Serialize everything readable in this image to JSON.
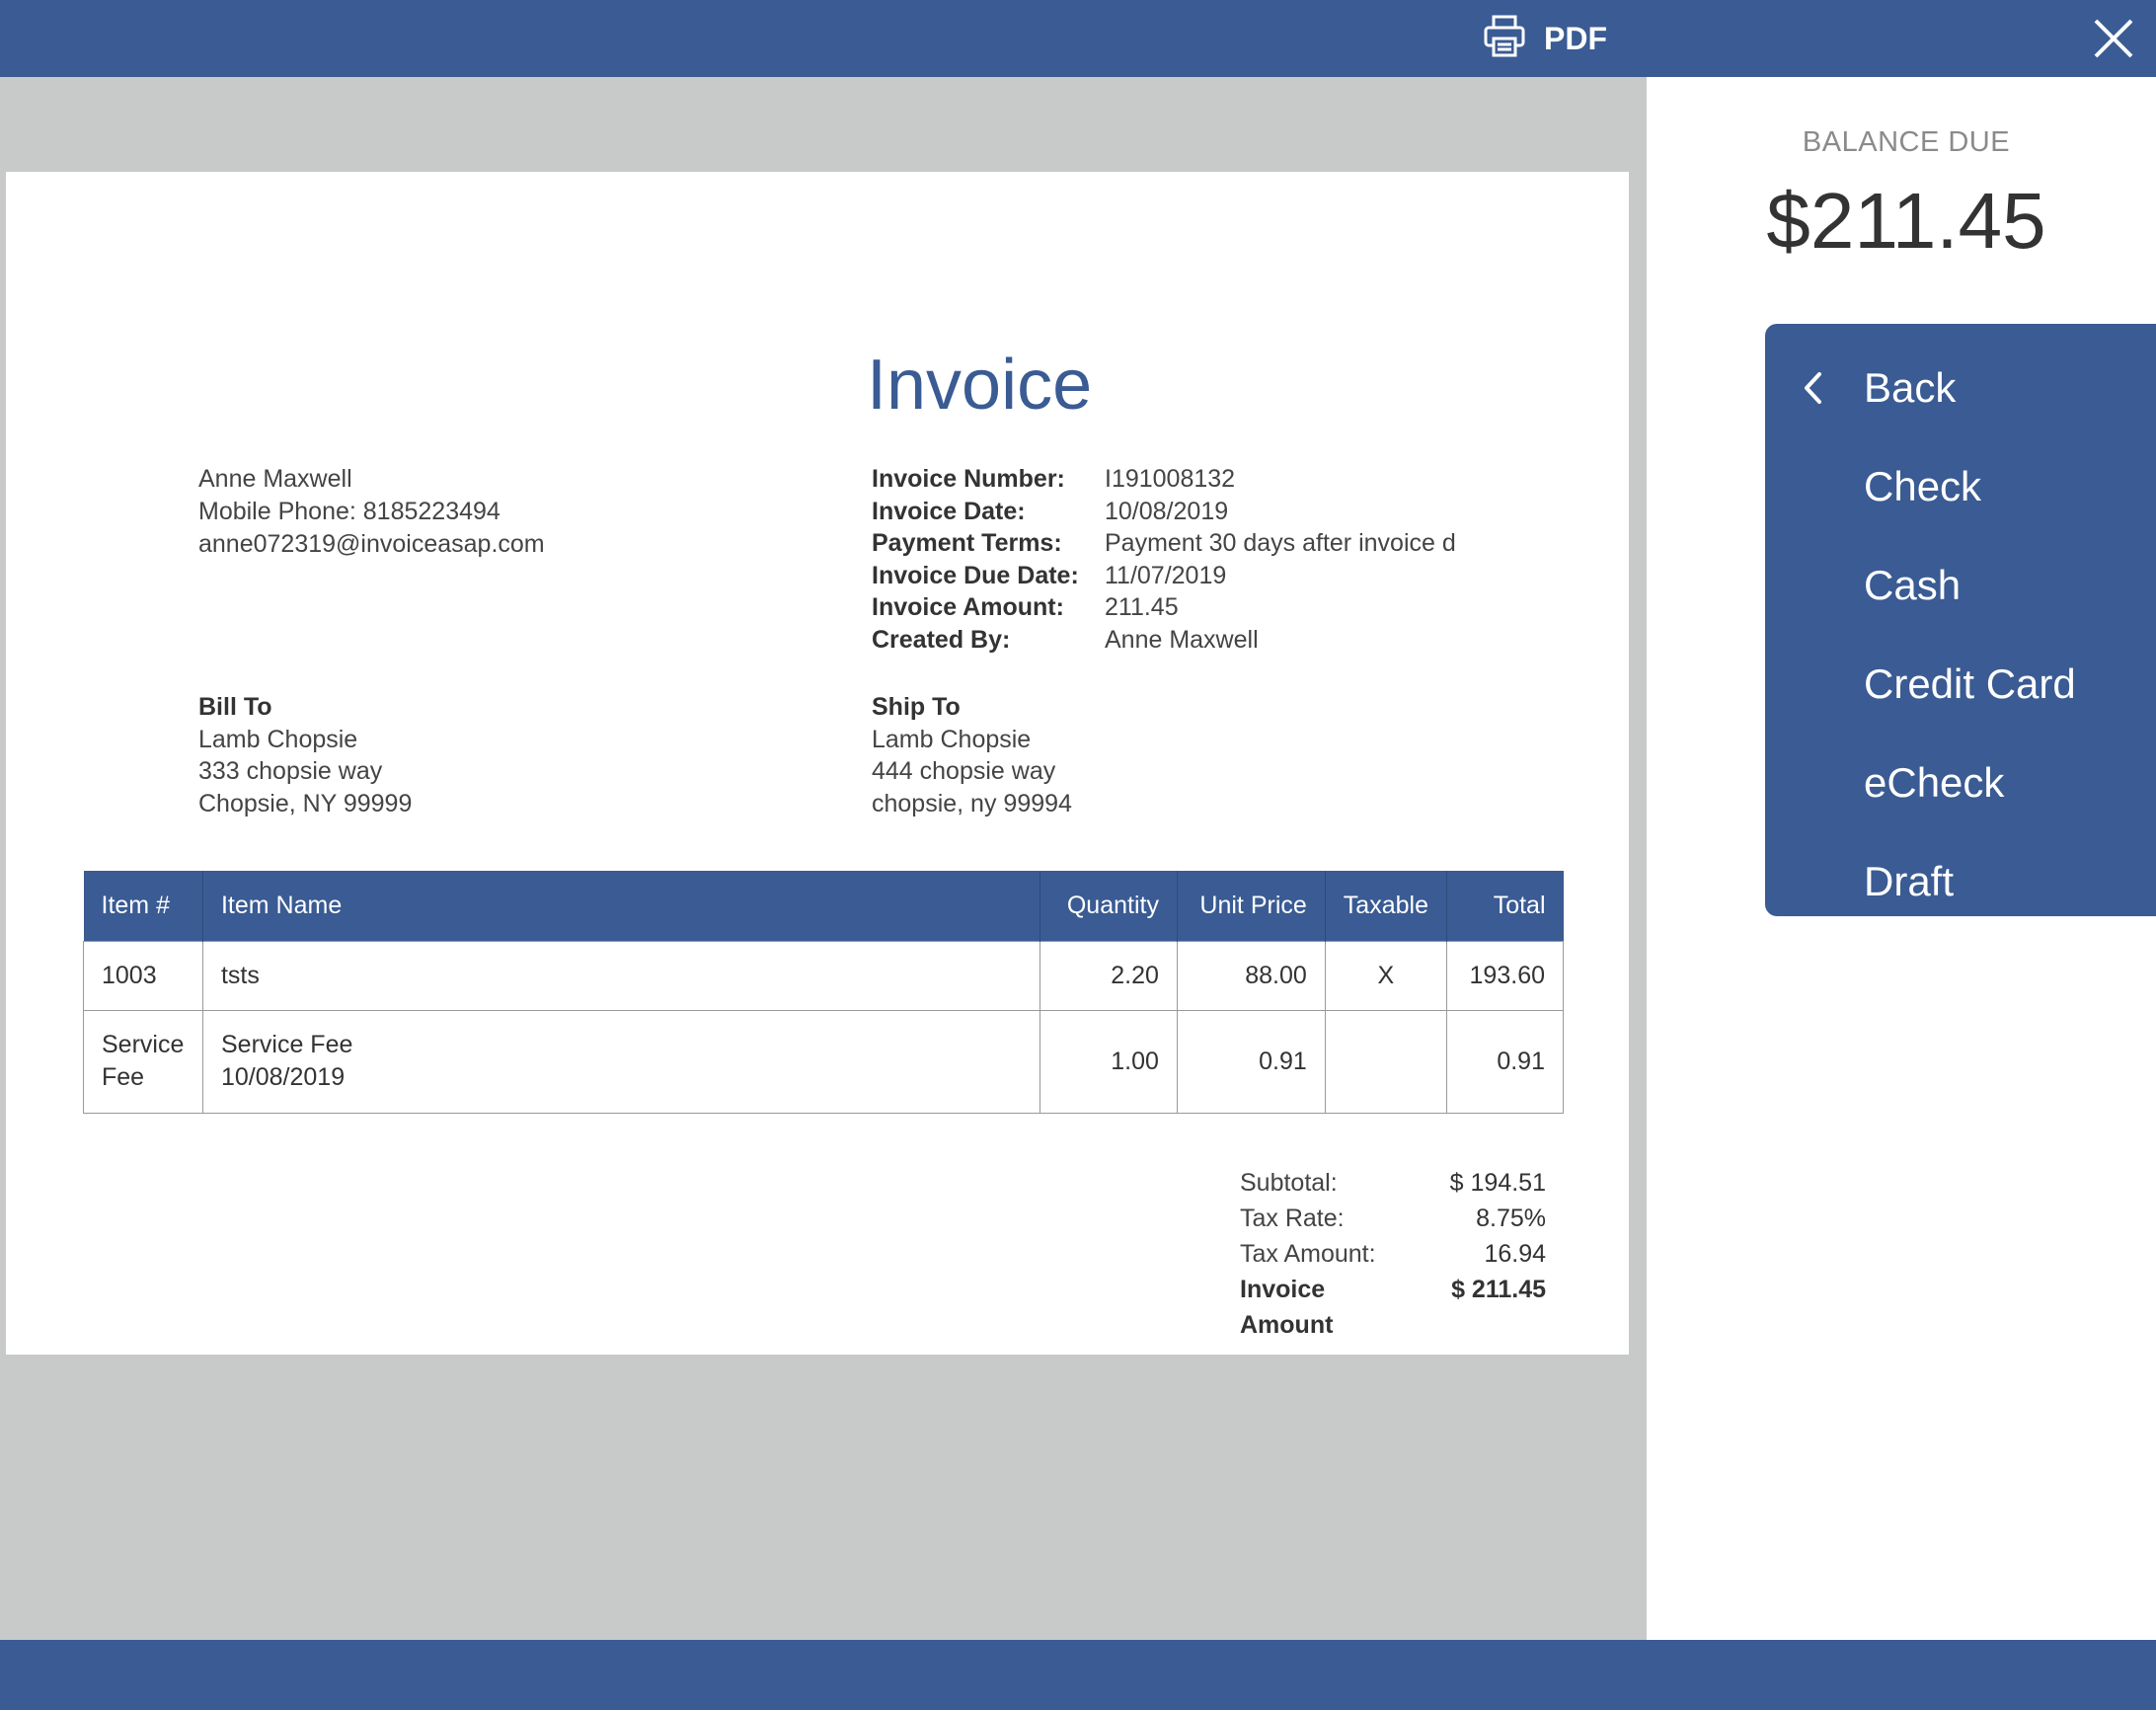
{
  "toolbar": {
    "pdf_label": "PDF"
  },
  "invoice": {
    "title": "Invoice",
    "from": {
      "name": "Anne Maxwell",
      "phone": "Mobile Phone: 8185223494",
      "email": "anne072319@invoiceasap.com"
    },
    "meta": [
      {
        "label": "Invoice Number:",
        "value": "I191008132"
      },
      {
        "label": "Invoice Date:",
        "value": "10/08/2019"
      },
      {
        "label": "Payment Terms:",
        "value": "Payment 30 days after invoice d"
      },
      {
        "label": "Invoice Due Date:",
        "value": "11/07/2019"
      },
      {
        "label": "Invoice Amount:",
        "value": "211.45"
      },
      {
        "label": "Created By:",
        "value": "Anne Maxwell"
      }
    ],
    "bill_to": {
      "heading": "Bill To",
      "lines": [
        "Lamb Chopsie",
        "333 chopsie way",
        "Chopsie, NY 99999"
      ]
    },
    "ship_to": {
      "heading": "Ship To",
      "lines": [
        "Lamb Chopsie",
        "444 chopsie way",
        "chopsie, ny 99994"
      ]
    },
    "table": {
      "headers": [
        "Item #",
        "Item Name",
        "Quantity",
        "Unit Price",
        "Taxable",
        "Total"
      ],
      "rows": [
        {
          "item_no": "1003",
          "item_name_line1": "tsts",
          "item_name_line2": "",
          "quantity": "2.20",
          "unit_price": "88.00",
          "taxable": "X",
          "total": "193.60"
        },
        {
          "item_no": "Service Fee",
          "item_name_line1": "Service Fee",
          "item_name_line2": "10/08/2019",
          "quantity": "1.00",
          "unit_price": "0.91",
          "taxable": "",
          "total": "0.91"
        }
      ]
    },
    "totals": [
      {
        "label": "Subtotal:",
        "value": "$ 194.51"
      },
      {
        "label": "Tax Rate:",
        "value": "8.75%"
      },
      {
        "label": "Tax Amount:",
        "value": "16.94"
      },
      {
        "label": "Invoice Amount",
        "value": "$ 211.45"
      }
    ]
  },
  "sidebar": {
    "balance_label": "BALANCE DUE",
    "balance_amount": "$211.45",
    "menu": [
      {
        "label": "Back",
        "icon": "chevron-left-icon"
      },
      {
        "label": "Check"
      },
      {
        "label": "Cash"
      },
      {
        "label": "Credit Card"
      },
      {
        "label": "eCheck"
      },
      {
        "label": "Draft"
      }
    ]
  },
  "colors": {
    "brand": "#3a5b93",
    "background": "#c8c9c9",
    "paper": "#ffffff"
  }
}
